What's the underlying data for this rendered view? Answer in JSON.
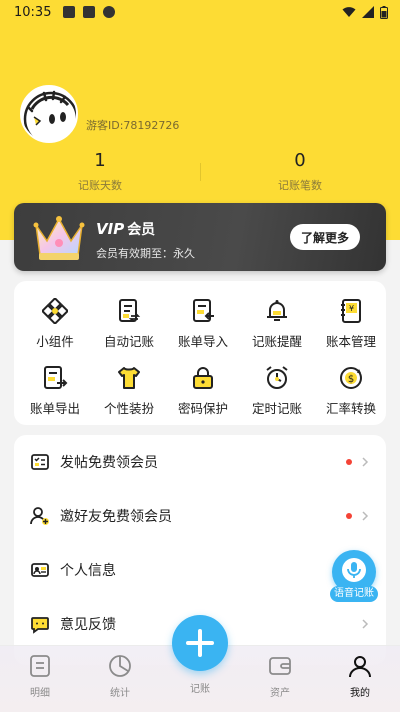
{
  "status_bar": {
    "time": "10:35"
  },
  "profile": {
    "guest_id": "游客ID:78192726",
    "stats": [
      {
        "value": "1",
        "label": "记账天数"
      },
      {
        "value": "0",
        "label": "记账笔数"
      }
    ]
  },
  "vip": {
    "badge": "VIP",
    "title": "会员",
    "subtitle": "会员有效期至：永久",
    "button": "了解更多"
  },
  "features": [
    {
      "label": "小组件",
      "icon": "widget-icon"
    },
    {
      "label": "自动记账",
      "icon": "auto-record-icon"
    },
    {
      "label": "账单导入",
      "icon": "bill-import-icon"
    },
    {
      "label": "记账提醒",
      "icon": "bell-icon"
    },
    {
      "label": "账本管理",
      "icon": "ledger-icon"
    },
    {
      "label": "账单导出",
      "icon": "bill-export-icon"
    },
    {
      "label": "个性装扮",
      "icon": "tshirt-icon"
    },
    {
      "label": "密码保护",
      "icon": "lock-icon"
    },
    {
      "label": "定时记账",
      "icon": "alarm-clock-icon"
    },
    {
      "label": "汇率转换",
      "icon": "currency-exchange-icon"
    }
  ],
  "list": [
    {
      "label": "发帖免费领会员",
      "icon": "post-icon",
      "dot": true
    },
    {
      "label": "邀好友免费领会员",
      "icon": "invite-user-icon",
      "dot": true
    },
    {
      "label": "个人信息",
      "icon": "id-card-icon",
      "dot": false
    },
    {
      "label": "意见反馈",
      "icon": "feedback-icon",
      "dot": false
    }
  ],
  "voice": {
    "label": "语音记账"
  },
  "nav": [
    {
      "label": "明细",
      "icon": "detail-icon"
    },
    {
      "label": "统计",
      "icon": "pie-chart-icon"
    },
    {
      "label": "记账",
      "icon": "add-icon"
    },
    {
      "label": "资产",
      "icon": "wallet-icon"
    },
    {
      "label": "我的",
      "icon": "user-icon"
    }
  ],
  "colors": {
    "brand_yellow": "#fddc34",
    "accent_blue": "#3ab4f2",
    "badge_red": "#f44336"
  }
}
